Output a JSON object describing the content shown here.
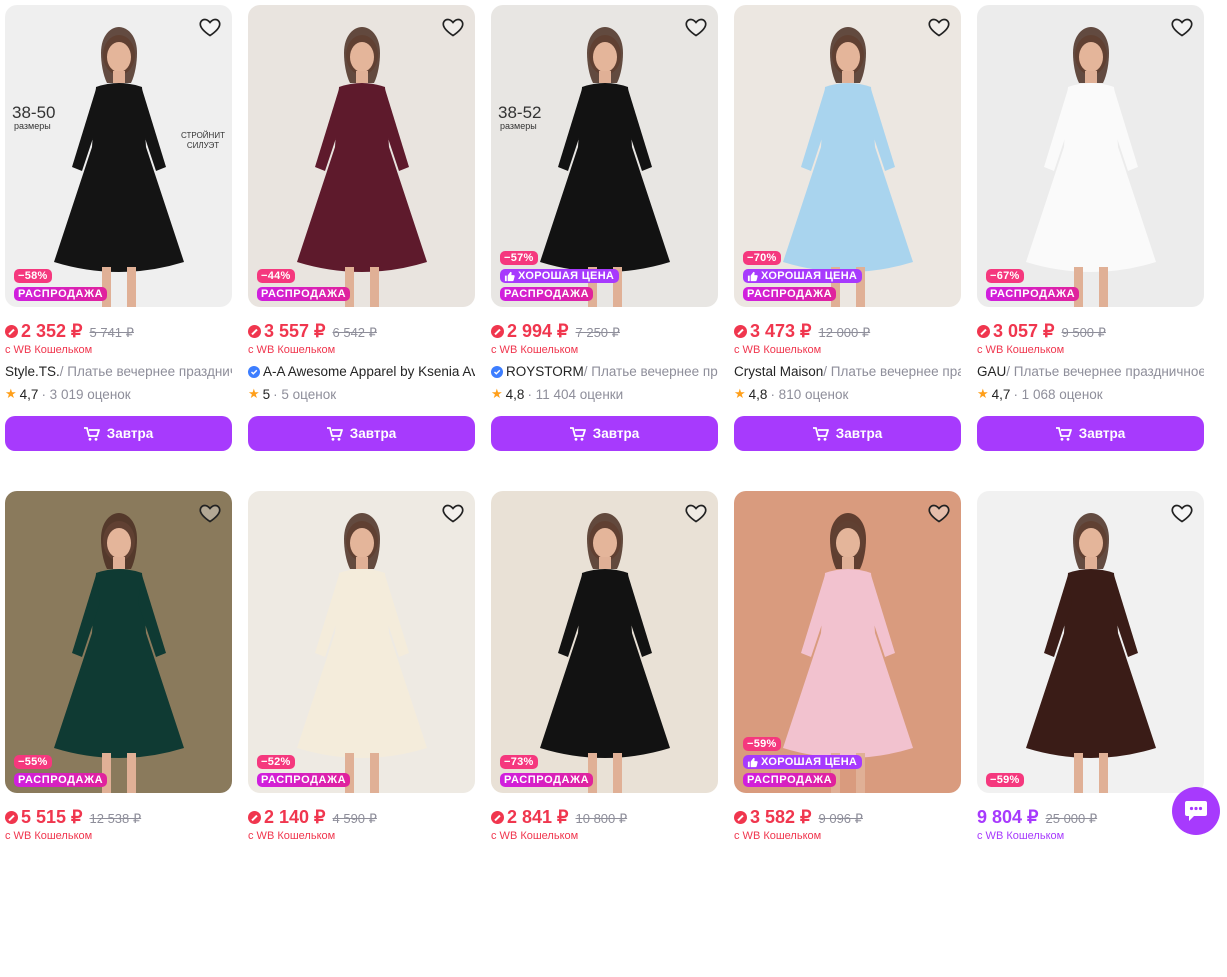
{
  "products": [
    {
      "discount": "−58%",
      "good_price": "",
      "sale": "РАСПРОДАЖА",
      "price": "2 352 ₽",
      "old_price": "5 741 ₽",
      "wallet": "с WB Кошельком",
      "brand": "Style.TS.",
      "name": " / Платье вечернее праздничное",
      "verified": false,
      "rating": "4,7",
      "reviews": "· 3 019 оценок",
      "button": "Завтра",
      "img_text1": "38-50",
      "img_text2": "размеры",
      "img_text3": "СТРОЙНИТ СИЛУЭТ",
      "bg": "#efefef",
      "dress": "#141414"
    },
    {
      "discount": "−44%",
      "good_price": "",
      "sale": "РАСПРОДАЖА",
      "price": "3 557 ₽",
      "old_price": "6 542 ₽",
      "wallet": "с WB Кошельком",
      "brand": "A-A Awesome Apparel by Ksenia Avakyan",
      "name": "",
      "verified": true,
      "rating": "5",
      "reviews": "· 5 оценок",
      "button": "Завтра",
      "img_text1": "",
      "img_text2": "",
      "img_text3": "",
      "bg": "#e9e4df",
      "dress": "#5e1a2c"
    },
    {
      "discount": "−57%",
      "good_price": "ХОРОШАЯ ЦЕНА",
      "sale": "РАСПРОДАЖА",
      "price": "2 994 ₽",
      "old_price": "7 250 ₽",
      "wallet": "с WB Кошельком",
      "brand": "ROYSTORM",
      "name": " / Платье вечернее праздничное",
      "verified": true,
      "rating": "4,8",
      "reviews": "· 11 404 оценки",
      "button": "Завтра",
      "img_text1": "38-52",
      "img_text2": "размеры",
      "img_text3": "",
      "bg": "#e8e6e3",
      "dress": "#121212"
    },
    {
      "discount": "−70%",
      "good_price": "ХОРОШАЯ ЦЕНА",
      "sale": "РАСПРОДАЖА",
      "price": "3 473 ₽",
      "old_price": "12 000 ₽",
      "wallet": "с WB Кошельком",
      "brand": "Crystal Maison",
      "name": " / Платье вечернее праздничное",
      "verified": false,
      "rating": "4,8",
      "reviews": "· 810 оценок",
      "button": "Завтра",
      "img_text1": "",
      "img_text2": "",
      "img_text3": "",
      "bg": "#ece7e1",
      "dress": "#a9d4ee"
    },
    {
      "discount": "−67%",
      "good_price": "",
      "sale": "РАСПРОДАЖА",
      "price": "3 057 ₽",
      "old_price": "9 500 ₽",
      "wallet": "с WB Кошельком",
      "brand": "GAU",
      "name": " / Платье вечернее праздничное",
      "verified": false,
      "rating": "4,7",
      "reviews": "· 1 068 оценок",
      "button": "Завтра",
      "img_text1": "",
      "img_text2": "",
      "img_text3": "",
      "bg": "#ececec",
      "dress": "#fafafa"
    },
    {
      "discount": "−55%",
      "good_price": "",
      "sale": "РАСПРОДАЖА",
      "price": "5 515 ₽",
      "old_price": "12 538 ₽",
      "wallet": "с WB Кошельком",
      "brand": "",
      "name": "",
      "verified": false,
      "rating": "",
      "reviews": "",
      "button": "",
      "img_text1": "",
      "img_text2": "",
      "img_text3": "",
      "bg": "#8a7a5c",
      "dress": "#0f3a33"
    },
    {
      "discount": "−52%",
      "good_price": "",
      "sale": "РАСПРОДАЖА",
      "price": "2 140 ₽",
      "old_price": "4 590 ₽",
      "wallet": "с WB Кошельком",
      "brand": "",
      "name": "",
      "verified": false,
      "rating": "",
      "reviews": "",
      "button": "",
      "img_text1": "",
      "img_text2": "",
      "img_text3": "",
      "bg": "#eeeae3",
      "dress": "#f4ecdb"
    },
    {
      "discount": "−73%",
      "good_price": "",
      "sale": "РАСПРОДАЖА",
      "price": "2 841 ₽",
      "old_price": "10 800 ₽",
      "wallet": "с WB Кошельком",
      "brand": "",
      "name": "",
      "verified": false,
      "rating": "",
      "reviews": "",
      "button": "",
      "img_text1": "",
      "img_text2": "",
      "img_text3": "",
      "bg": "#e9e1d6",
      "dress": "#121212"
    },
    {
      "discount": "−59%",
      "good_price": "ХОРОШАЯ ЦЕНА",
      "sale": "РАСПРОДАЖА",
      "price": "3 582 ₽",
      "old_price": "9 096 ₽",
      "wallet": "с WB Кошельком",
      "brand": "",
      "name": "",
      "verified": false,
      "rating": "",
      "reviews": "",
      "button": "",
      "img_text1": "",
      "img_text2": "",
      "img_text3": "",
      "bg": "#d99b7e",
      "dress": "#f2c2cf"
    },
    {
      "discount": "−59%",
      "good_price": "",
      "sale": "",
      "price": "9 804 ₽",
      "old_price": "25 000 ₽",
      "wallet": "с WB Кошельком",
      "brand": "",
      "name": "",
      "verified": false,
      "rating": "",
      "reviews": "",
      "button": "",
      "img_text1": "",
      "img_text2": "",
      "img_text3": "",
      "bg": "#f1f1f1",
      "dress": "#3a1c17",
      "purple": true
    }
  ],
  "colors": {
    "accent": "#a73afd",
    "price": "#f0364e",
    "discount": "#f5387e",
    "sale_from": "#d01fe0",
    "sale_to": "#e0229b",
    "star": "#ff9f1a"
  },
  "icons": {
    "favorite": "heart-outline-icon",
    "cart": "cart-icon",
    "thumb": "thumb-up-icon",
    "wallet": "wallet-discount-icon",
    "chat": "chat-icon"
  }
}
